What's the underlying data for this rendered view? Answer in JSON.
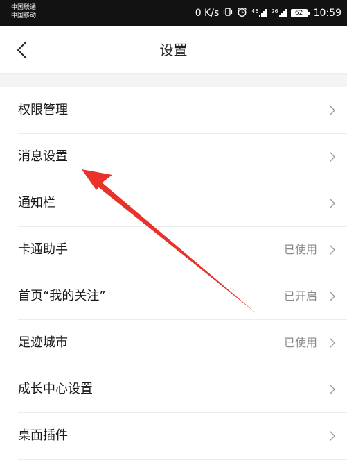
{
  "status_bar": {
    "carrier_1": "中国联通",
    "carrier_2": "中国移动",
    "net_speed": "0 K/s",
    "signal_1_label": "46",
    "signal_2_label": "26",
    "battery": "62",
    "time": "10:59"
  },
  "header": {
    "title": "设置",
    "back_icon": "back-chevron-icon"
  },
  "settings": {
    "items": [
      {
        "label": "权限管理",
        "status": ""
      },
      {
        "label": "消息设置",
        "status": ""
      },
      {
        "label": "通知栏",
        "status": ""
      },
      {
        "label": "卡通助手",
        "status": "已使用"
      },
      {
        "label": "首页“我的关注”",
        "status": "已开启"
      },
      {
        "label": "足迹城市",
        "status": "已使用"
      },
      {
        "label": "成长中心设置",
        "status": ""
      },
      {
        "label": "桌面插件",
        "status": ""
      }
    ],
    "chevron_icon": "chevron-right-icon"
  },
  "colors": {
    "status_bar_bg": "#121212",
    "divider": "#ececec",
    "secondary_text": "#8a8a8a",
    "annotation_arrow": "#e8322a"
  }
}
